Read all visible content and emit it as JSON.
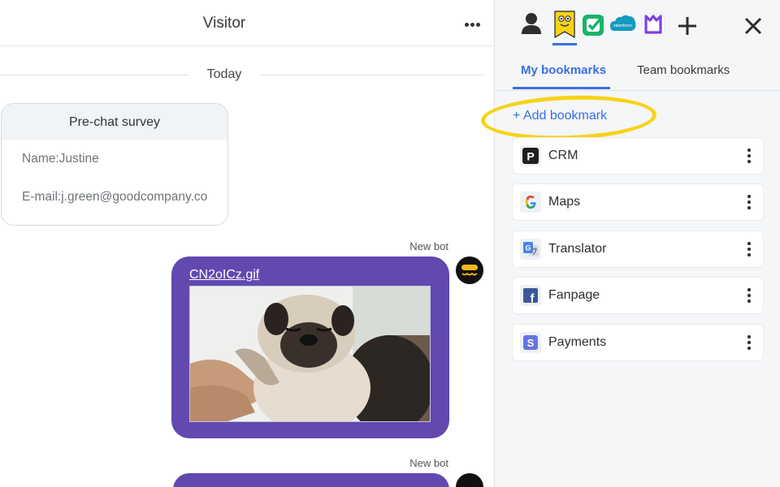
{
  "chat": {
    "title": "Visitor",
    "day_label": "Today",
    "survey": {
      "title": "Pre-chat survey",
      "name_line": "Name:Justine",
      "email_line": "E-mail:j.green@goodcompany.co"
    },
    "messages": [
      {
        "sender": "New bot",
        "attachment_name": "CN2oICz.gif"
      },
      {
        "sender": "New bot"
      }
    ]
  },
  "sidebar": {
    "apps": [
      "person-icon",
      "bookmark-app-icon",
      "checklist-app-icon",
      "salesforce-icon",
      "livechat-app-icon",
      "plus-icon"
    ],
    "app_labels": {
      "salesforce": "salesforce"
    },
    "tabs": [
      "My bookmarks",
      "Team bookmarks"
    ],
    "add_label": "+ Add bookmark",
    "bookmarks": [
      {
        "label": "CRM",
        "icon": "crm-icon",
        "color": "#1a1a1a",
        "letter": "P"
      },
      {
        "label": "Maps",
        "icon": "google-icon",
        "color": "#4285f4",
        "letter": "G"
      },
      {
        "label": "Translator",
        "icon": "google-translate-icon",
        "color": "#4a86e8",
        "letter": "G"
      },
      {
        "label": "Fanpage",
        "icon": "facebook-icon",
        "color": "#3b5998",
        "letter": "f"
      },
      {
        "label": "Payments",
        "icon": "stripe-icon",
        "color": "#6772e5",
        "letter": "S"
      }
    ]
  },
  "colors": {
    "accent": "#3b6fe0",
    "bot_bubble": "#6249b0",
    "highlight": "#f6d319"
  }
}
